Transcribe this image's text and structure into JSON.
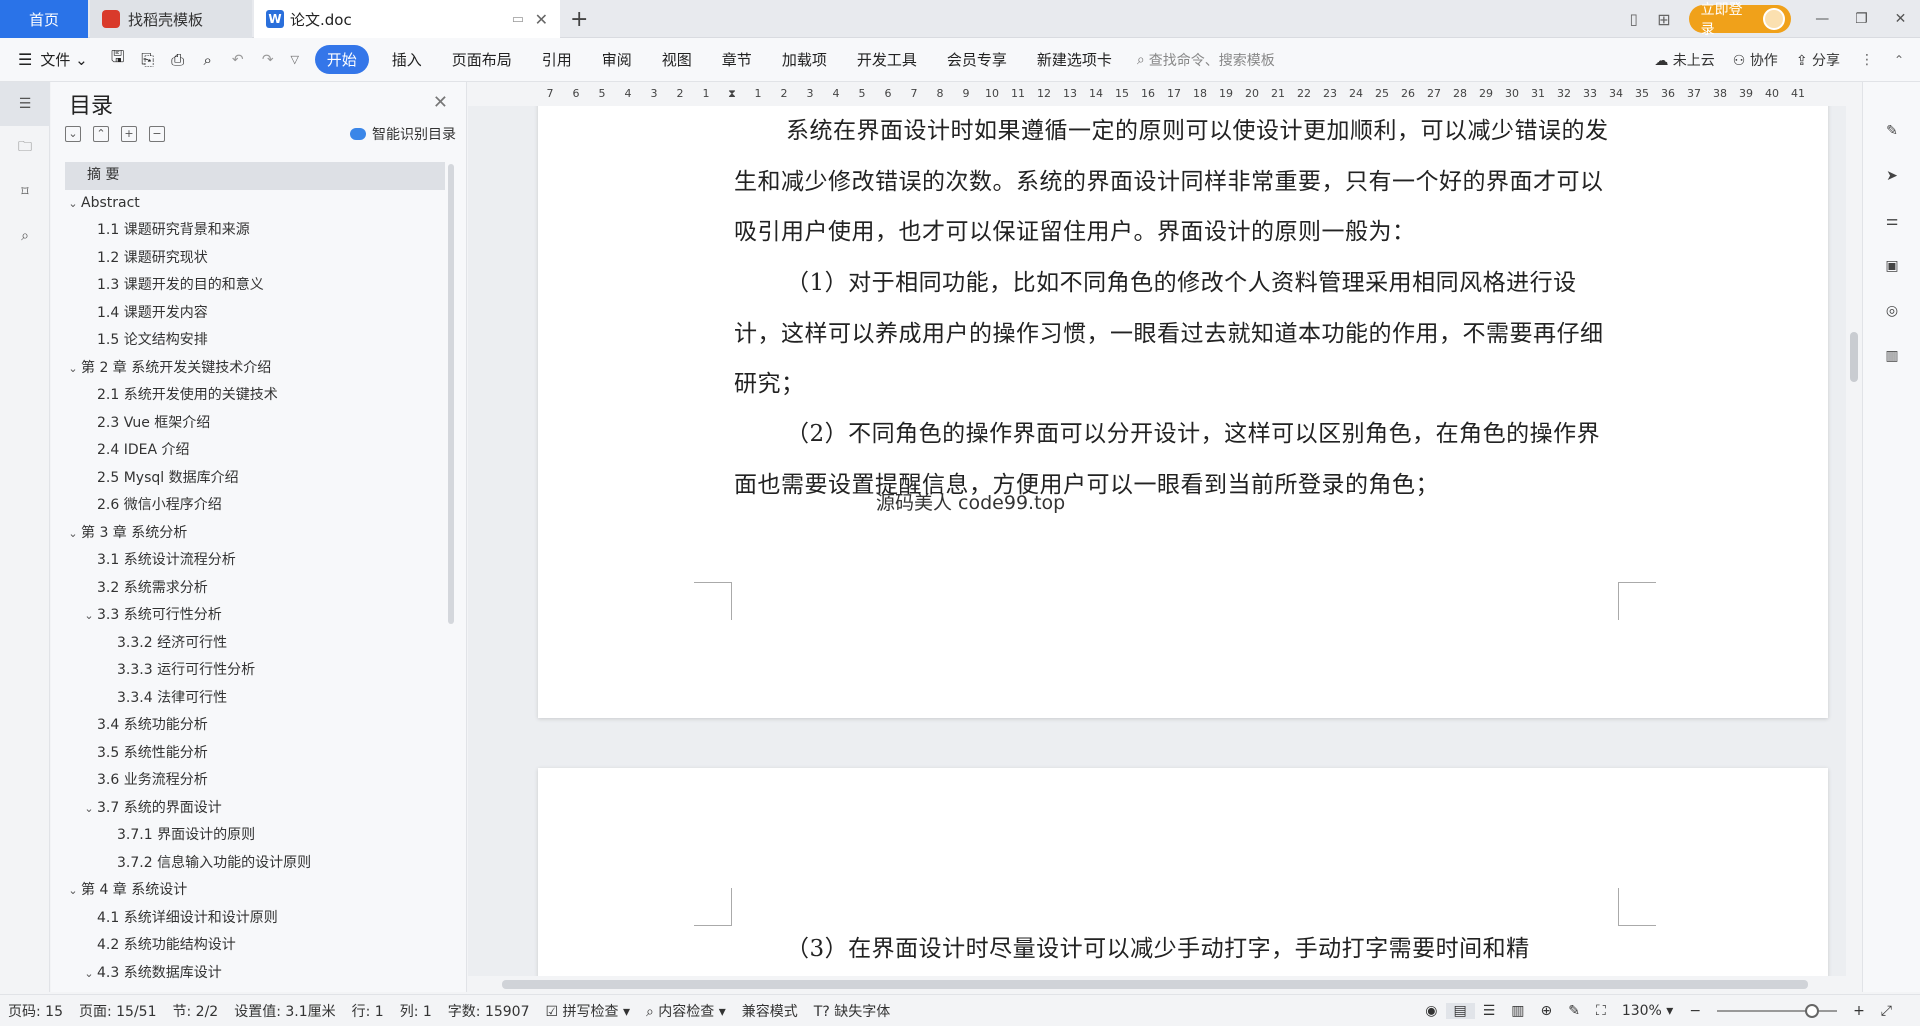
{
  "tabs": {
    "home": "首页",
    "daoke": "找稻壳模板",
    "doc": "论文.doc",
    "new_tab": "+"
  },
  "titlebar": {
    "login": "立即登录"
  },
  "menubar": {
    "file": "文件",
    "items": [
      "开始",
      "插入",
      "页面布局",
      "引用",
      "审阅",
      "视图",
      "章节",
      "加载项",
      "开发工具",
      "会员专享",
      "新建选项卡"
    ],
    "search_placeholder": "查找命令、搜索模板",
    "cloud": "未上云",
    "collab": "协作",
    "share": "分享"
  },
  "toc": {
    "title": "目录",
    "smart": "智能识别目录",
    "items": [
      {
        "label": "摘  要",
        "level": 0,
        "caret": ""
      },
      {
        "label": "Abstract",
        "level": 0,
        "caret": "v"
      },
      {
        "label": "1.1 课题研究背景和来源",
        "level": 1,
        "caret": ""
      },
      {
        "label": "1.2 课题研究现状",
        "level": 1,
        "caret": ""
      },
      {
        "label": "1.3 课题开发的目的和意义",
        "level": 1,
        "caret": ""
      },
      {
        "label": "1.4 课题开发内容",
        "level": 1,
        "caret": ""
      },
      {
        "label": "1.5 论文结构安排",
        "level": 1,
        "caret": ""
      },
      {
        "label": "第 2 章  系统开发关键技术介绍",
        "level": 0,
        "caret": "v"
      },
      {
        "label": "2.1 系统开发使用的关键技术",
        "level": 1,
        "caret": ""
      },
      {
        "label": "2.3 Vue 框架介绍",
        "level": 1,
        "caret": ""
      },
      {
        "label": "2.4 IDEA 介绍",
        "level": 1,
        "caret": ""
      },
      {
        "label": "2.5 Mysql 数据库介绍",
        "level": 1,
        "caret": ""
      },
      {
        "label": "2.6 微信小程序介绍",
        "level": 1,
        "caret": ""
      },
      {
        "label": "第 3 章  系统分析",
        "level": 0,
        "caret": "v"
      },
      {
        "label": "3.1 系统设计流程分析",
        "level": 1,
        "caret": ""
      },
      {
        "label": "3.2 系统需求分析",
        "level": 1,
        "caret": ""
      },
      {
        "label": "3.3 系统可行性分析",
        "level": 1,
        "caret": "v"
      },
      {
        "label": "3.3.2 经济可行性",
        "level": 2,
        "caret": ""
      },
      {
        "label": "3.3.3 运行可行性分析",
        "level": 2,
        "caret": ""
      },
      {
        "label": "3.3.4 法律可行性",
        "level": 2,
        "caret": ""
      },
      {
        "label": "3.4 系统功能分析",
        "level": 1,
        "caret": ""
      },
      {
        "label": "3.5 系统性能分析",
        "level": 1,
        "caret": ""
      },
      {
        "label": "3.6 业务流程分析",
        "level": 1,
        "caret": ""
      },
      {
        "label": "3.7 系统的界面设计",
        "level": 1,
        "caret": "v"
      },
      {
        "label": "3.7.1 界面设计的原则",
        "level": 2,
        "caret": ""
      },
      {
        "label": "3.7.2 信息输入功能的设计原则",
        "level": 2,
        "caret": ""
      },
      {
        "label": "第 4 章  系统设计",
        "level": 0,
        "caret": "v"
      },
      {
        "label": "4.1 系统详细设计和设计原则",
        "level": 1,
        "caret": ""
      },
      {
        "label": "4.2 系统功能结构设计",
        "level": 1,
        "caret": ""
      },
      {
        "label": "4.3 系统数据库设计",
        "level": 1,
        "caret": "v"
      }
    ]
  },
  "ruler": [
    "7",
    "6",
    "5",
    "4",
    "3",
    "2",
    "1",
    "",
    "1",
    "2",
    "3",
    "4",
    "5",
    "6",
    "7",
    "8",
    "9",
    "10",
    "11",
    "12",
    "13",
    "14",
    "15",
    "16",
    "17",
    "18",
    "19",
    "20",
    "21",
    "22",
    "23",
    "24",
    "25",
    "26",
    "27",
    "28",
    "29",
    "30",
    "31",
    "32",
    "33",
    "34",
    "35",
    "36",
    "37",
    "38",
    "39",
    "40",
    "41"
  ],
  "document": {
    "para1": "系统在界面设计时如果遵循一定的原则可以使设计更加顺利，可以减少错误的发生和减少修改错误的次数。系统的界面设计同样非常重要，只有一个好的界面才可以吸引用户使用，也才可以保证留住用户。界面设计的原则一般为：",
    "para2": "（1）对于相同功能，比如不同角色的修改个人资料管理采用相同风格进行设计，这样可以养成用户的操作习惯，一眼看过去就知道本功能的作用，不需要再仔细研究；",
    "para3": "（2）不同角色的操作界面可以分开设计，这样可以区别角色，在角色的操作界面也需要设置提醒信息，方便用户可以一眼看到当前所登录的角色；",
    "watermark": "源码美人 code99.top",
    "para4": "（3）在界面设计时尽量设计可以减少手动打字，手动打字需要时间和精"
  },
  "status": {
    "page_no": "页码: 15",
    "page": "页面: 15/51",
    "section": "节: 2/2",
    "setting": "设置值: 3.1厘米",
    "row": "行: 1",
    "col": "列: 1",
    "words": "字数: 15907",
    "spell": "拼写检查",
    "content": "内容检查",
    "compat": "兼容模式",
    "missing_font": "缺失字体",
    "zoom": "130%"
  }
}
